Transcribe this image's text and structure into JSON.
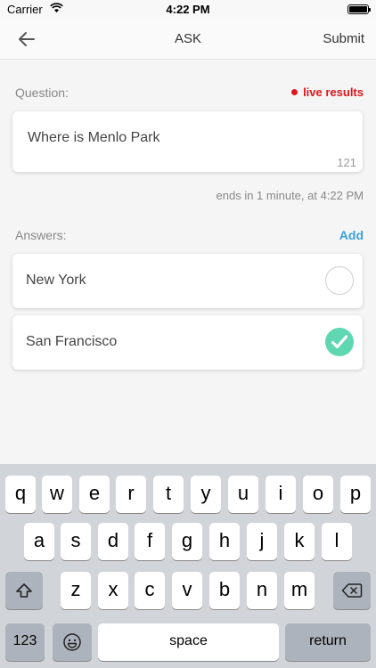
{
  "status_bar": {
    "carrier": "Carrier",
    "time": "4:22 PM"
  },
  "nav": {
    "title": "ASK",
    "submit_label": "Submit"
  },
  "question": {
    "label": "Question:",
    "live_label": "live results",
    "text": "Where is Menlo Park",
    "char_count": "121",
    "ends_text": "ends in 1 minute, at 4:22 PM"
  },
  "answers": {
    "label": "Answers:",
    "add_label": "Add",
    "items": [
      {
        "text": "New York",
        "selected": false
      },
      {
        "text": "San Francisco",
        "selected": true
      }
    ]
  },
  "keyboard": {
    "row1": [
      "q",
      "w",
      "e",
      "r",
      "t",
      "y",
      "u",
      "i",
      "o",
      "p"
    ],
    "row2": [
      "a",
      "s",
      "d",
      "f",
      "g",
      "h",
      "j",
      "k",
      "l"
    ],
    "row3": [
      "z",
      "x",
      "c",
      "v",
      "b",
      "n",
      "m"
    ],
    "numbers_label": "123",
    "space_label": "space",
    "return_label": "return"
  },
  "colors": {
    "live_red": "#e0161e",
    "link_blue": "#3aa0e0",
    "check_green": "#5fd7b0"
  }
}
